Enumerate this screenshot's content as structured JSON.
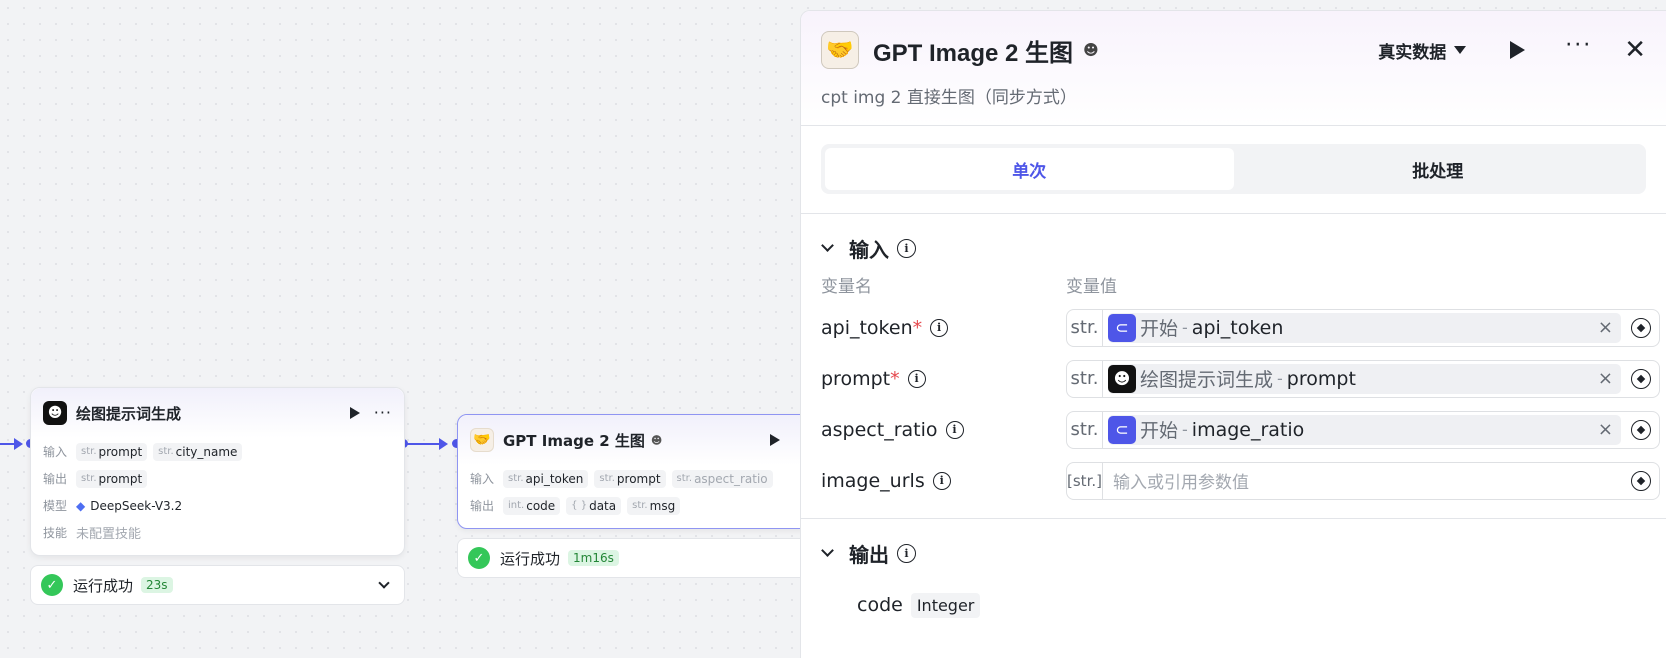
{
  "nodes": {
    "prompt_gen": {
      "title": "绘图提示词生成",
      "input_label": "输入",
      "output_label": "输出",
      "model_label": "模型",
      "skill_label": "技能",
      "inputs": [
        {
          "type": "str.",
          "name": "prompt"
        },
        {
          "type": "str.",
          "name": "city_name"
        }
      ],
      "outputs": [
        {
          "type": "str.",
          "name": "prompt"
        }
      ],
      "model": "DeepSeek-V3.2",
      "skill": "未配置技能",
      "status": "运行成功",
      "time": "23s"
    },
    "gpt_image": {
      "title": "GPT Image 2 生图",
      "input_label": "输入",
      "output_label": "输出",
      "inputs": [
        {
          "type": "str.",
          "name": "api_token"
        },
        {
          "type": "str.",
          "name": "prompt"
        },
        {
          "type": "str.",
          "name": "aspect_ratio"
        }
      ],
      "outputs": [
        {
          "type": "int.",
          "name": "code"
        },
        {
          "type": "{ }",
          "name": "data"
        },
        {
          "type": "str.",
          "name": "msg"
        }
      ],
      "status": "运行成功",
      "time": "1m16s"
    }
  },
  "panel": {
    "title": "GPT Image 2 生图",
    "subtitle": "cpt img 2 直接生图（同步方式）",
    "mode": "真实数据",
    "tabs": [
      "单次",
      "批处理"
    ],
    "input_section": "输入",
    "output_section": "输出",
    "col_name": "变量名",
    "col_value": "变量值",
    "variables": [
      {
        "name": "api_token",
        "required": "*",
        "type": "str.",
        "source": "开始",
        "sep": "-",
        "ref": "api_token"
      },
      {
        "name": "prompt",
        "required": "*",
        "type": "str.",
        "source": "绘图提示词生成",
        "sep": "-",
        "ref": "prompt"
      },
      {
        "name": "aspect_ratio",
        "required": "",
        "type": "str.",
        "source": "开始",
        "sep": "-",
        "ref": "image_ratio"
      },
      {
        "name": "image_urls",
        "required": "",
        "type": "[str.]",
        "placeholder": "输入或引用参数值"
      }
    ],
    "outputs": [
      {
        "name": "code",
        "type": "Integer"
      }
    ]
  },
  "icons": {
    "node_prompt": "robot-icon",
    "node_gpt": "handshake-icon",
    "start": "start-icon"
  },
  "colors": {
    "accent": "#4e56e8",
    "success": "#34c759",
    "required": "#e5484d"
  }
}
